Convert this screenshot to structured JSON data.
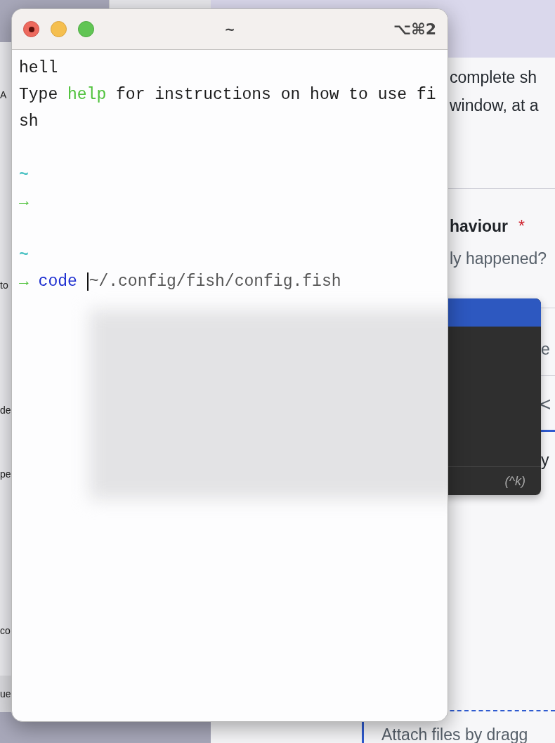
{
  "left_window": {
    "texts": [
      "A",
      "to",
      "de",
      "pe",
      "co",
      "ue"
    ]
  },
  "browser": {
    "texts": [
      {
        "kind": "body",
        "text": "complete sh"
      },
      {
        "kind": "body",
        "text": "window, at a"
      },
      {
        "kind": "heading",
        "text": "haviour",
        "required_mark": "*"
      },
      {
        "kind": "hint",
        "text": "ly happened?"
      },
      {
        "kind": "tab",
        "text": "e"
      },
      {
        "kind": "chevron",
        "text": "<"
      },
      {
        "kind": "body",
        "text": "y"
      },
      {
        "kind": "drop",
        "text": "Attach files by dragg"
      }
    ]
  },
  "popup": {
    "shortcut": "(^k)"
  },
  "terminal": {
    "title": "~",
    "shortcut": "⌥⌘2",
    "blocks": [
      {
        "lines": [
          [
            {
              "kind": "plain",
              "text": "hell"
            }
          ],
          [
            {
              "kind": "plain",
              "text": "Type "
            },
            {
              "kind": "command",
              "text": "help"
            },
            {
              "kind": "plain",
              "text": " for instructions on how to use fi"
            }
          ],
          [
            {
              "kind": "plain",
              "text": "sh"
            }
          ]
        ]
      },
      {
        "lines": [
          [
            {
              "kind": "dir",
              "text": "~"
            }
          ],
          [
            {
              "kind": "prompt",
              "text": "→"
            }
          ]
        ]
      },
      {
        "lines": [
          [
            {
              "kind": "dir",
              "text": "~"
            }
          ],
          [
            {
              "kind": "prompt",
              "text": "→"
            },
            {
              "kind": "valid",
              "text": "code"
            },
            {
              "kind": "cursor"
            },
            {
              "kind": "arg",
              "text": "~/.config/fish/config.fish"
            }
          ]
        ]
      }
    ]
  }
}
